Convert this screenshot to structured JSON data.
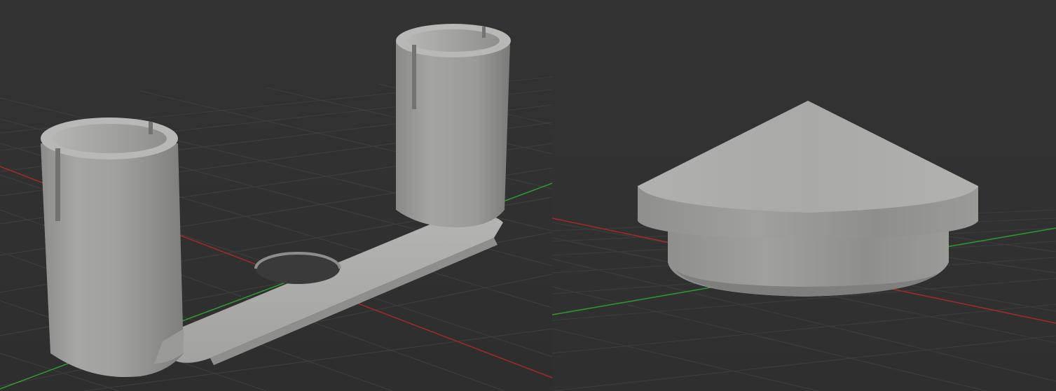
{
  "viewports": [
    {
      "id": "left",
      "model": "bracket-with-two-tubes",
      "background": "#333333",
      "grid_color": "#474747",
      "x_axis_color": "#b32424",
      "y_axis_color": "#2aa12a",
      "model_color": "#9d9d9b"
    },
    {
      "id": "right",
      "model": "conical-cap",
      "background": "#333333",
      "grid_color": "#474747",
      "x_axis_color": "#b32424",
      "y_axis_color": "#2aa12a",
      "model_color": "#a3a39f"
    }
  ]
}
